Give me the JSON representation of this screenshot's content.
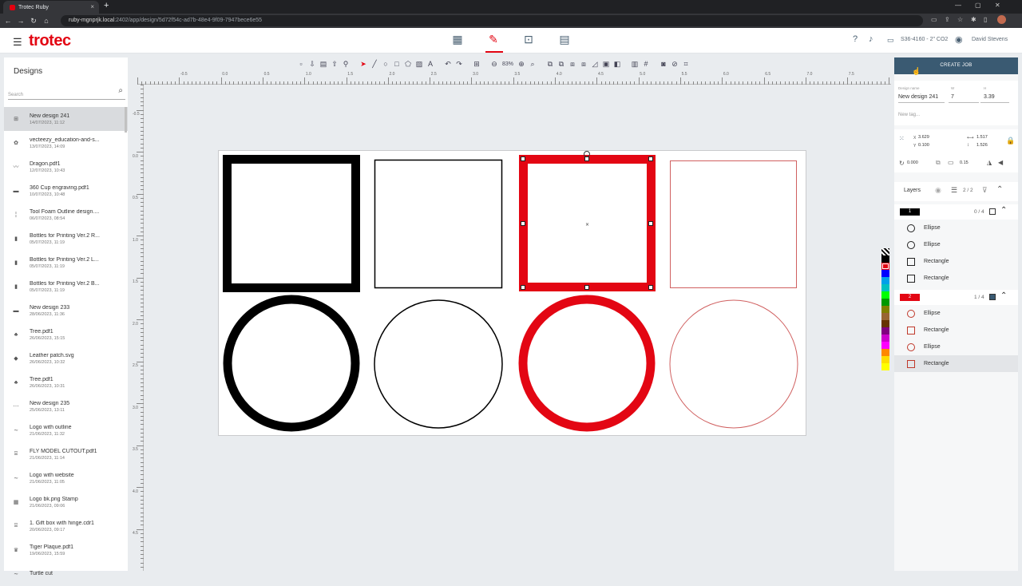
{
  "browser": {
    "tab_title": "Trotec Ruby",
    "url_host": "ruby-mgnprjk.local",
    "url_path": ":2402/app/design/5d72f54c-ad7b-48e4-9f09-7947bece6e55",
    "new_tab": "+",
    "close_tab": "×"
  },
  "header": {
    "logo": "trotec",
    "machine": "S36-4160 - 2\" CO2",
    "user": "David Stevens"
  },
  "sidebar": {
    "title": "Designs",
    "search_placeholder": "Search",
    "items": [
      {
        "name": "New design 241",
        "date": "14/07/2023, 11:12"
      },
      {
        "name": "vecteezy_education-and-s...",
        "date": "13/07/2023, 14:09"
      },
      {
        "name": "Dragon.pdf1",
        "date": "12/07/2023, 10:43"
      },
      {
        "name": "360 Cup engraving.pdf1",
        "date": "10/07/2023, 10:48"
      },
      {
        "name": "Tool Foam Outline design....",
        "date": "06/07/2023, 08:54"
      },
      {
        "name": "Bottles for Printing Ver.2 R...",
        "date": "05/07/2023, 11:19"
      },
      {
        "name": "Bottles for Printing Ver.2 L...",
        "date": "05/07/2023, 11:19"
      },
      {
        "name": "Bottles for Printing Ver.2 B...",
        "date": "05/07/2023, 11:19"
      },
      {
        "name": "New design 233",
        "date": "28/06/2023, 11:36"
      },
      {
        "name": "Tree.pdf1",
        "date": "26/06/2023, 15:15"
      },
      {
        "name": "Leather patch.svg",
        "date": "26/06/2023, 10:32"
      },
      {
        "name": "Tree.pdf1",
        "date": "26/06/2023, 10:31"
      },
      {
        "name": "New design 235",
        "date": "25/06/2023, 13:11"
      },
      {
        "name": "Logo with outline",
        "date": "21/06/2023, 11:32"
      },
      {
        "name": "FLY MODEL CUTOUT.pdf1",
        "date": "21/06/2023, 11:14"
      },
      {
        "name": "Logo with website",
        "date": "21/06/2023, 11:05"
      },
      {
        "name": "Logo bk.png Stamp",
        "date": "21/06/2023, 09:06"
      },
      {
        "name": "1. Gift box with hinge.cdr1",
        "date": "20/06/2023, 09:17"
      },
      {
        "name": "Tiger Plaque.pdf1",
        "date": "19/06/2023, 15:59"
      },
      {
        "name": "Turtle cut",
        "date": ""
      }
    ]
  },
  "toolbar": {
    "zoom": "83%"
  },
  "ruler": {
    "h_labels": [
      "-0.5",
      "0.0",
      "0.5",
      "1.0",
      "1.5",
      "2.0",
      "2.5",
      "3.0",
      "3.5",
      "4.0",
      "4.5",
      "5.0",
      "5.5",
      "6.0",
      "6.5",
      "7.0",
      "7.5"
    ],
    "v_labels": [
      "-0.5",
      "0.0",
      "0.5",
      "1.0",
      "1.5",
      "2.0",
      "2.5",
      "3.0",
      "3.5",
      "4.0",
      "4.5"
    ]
  },
  "right_panel": {
    "create_job": "CREATE JOB",
    "design_name_label": "Design name",
    "design_name": "New design 241",
    "w_label": "W",
    "w_value": "7",
    "h_label": "H",
    "h_value": "3.39",
    "tag_placeholder": "New tag...",
    "x": "3.629",
    "y": "0.100",
    "width": "1.517",
    "height": "1.526",
    "rotation": "0.000",
    "corner": "0.15",
    "layers_label": "Layers",
    "layers_count": "2 / 2",
    "layer_groups": [
      {
        "id": "1",
        "color": "#000000",
        "count": "0 / 4",
        "items": [
          {
            "type": "Ellipse"
          },
          {
            "type": "Ellipse"
          },
          {
            "type": "Rectangle"
          },
          {
            "type": "Rectangle"
          }
        ]
      },
      {
        "id": "2",
        "color": "#e30613",
        "count": "1 / 4",
        "items": [
          {
            "type": "Ellipse"
          },
          {
            "type": "Rectangle"
          },
          {
            "type": "Ellipse"
          },
          {
            "type": "Rectangle"
          }
        ]
      }
    ]
  },
  "palette": [
    "#000000",
    "#e30613",
    "#0000ff",
    "#00a0e9",
    "#00c0c0",
    "#00ff00",
    "#009900",
    "#808000",
    "#996633",
    "#663300",
    "#800080",
    "#cc00cc",
    "#ff00ff",
    "#ff8800",
    "#ffdd00",
    "#ffff00"
  ]
}
